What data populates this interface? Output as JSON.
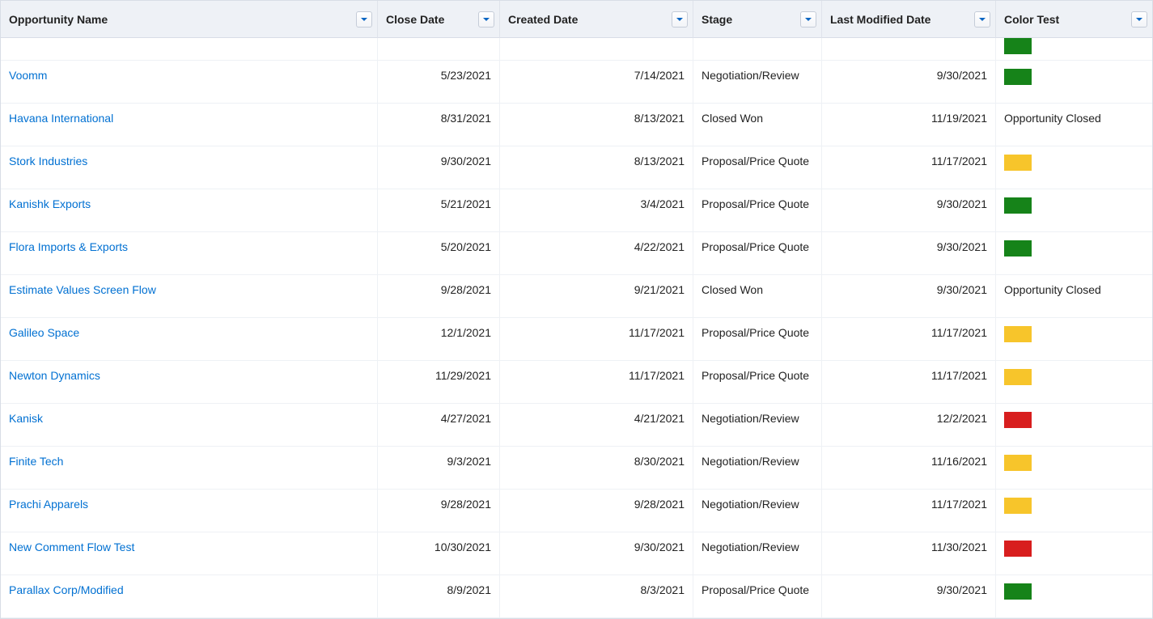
{
  "columns": [
    {
      "key": "name",
      "label": "Opportunity Name"
    },
    {
      "key": "close",
      "label": "Close Date"
    },
    {
      "key": "created",
      "label": "Created Date"
    },
    {
      "key": "stage",
      "label": "Stage"
    },
    {
      "key": "modified",
      "label": "Last Modified Date"
    },
    {
      "key": "color",
      "label": "Color Test"
    }
  ],
  "colors": {
    "green": "#168319",
    "yellow": "#f7c52b",
    "red": "#d81e1e"
  },
  "rows": [
    {
      "name": "",
      "close": "",
      "created": "",
      "stage": "",
      "modified": "",
      "color_type": "swatch",
      "color_value": "green",
      "partial": true
    },
    {
      "name": "Voomm",
      "close": "5/23/2021",
      "created": "7/14/2021",
      "stage": "Negotiation/Review",
      "modified": "9/30/2021",
      "color_type": "swatch",
      "color_value": "green"
    },
    {
      "name": "Havana International",
      "close": "8/31/2021",
      "created": "8/13/2021",
      "stage": "Closed Won",
      "modified": "11/19/2021",
      "color_type": "text",
      "color_value": "Opportunity Closed"
    },
    {
      "name": "Stork Industries",
      "close": "9/30/2021",
      "created": "8/13/2021",
      "stage": "Proposal/Price Quote",
      "modified": "11/17/2021",
      "color_type": "swatch",
      "color_value": "yellow"
    },
    {
      "name": "Kanishk Exports",
      "close": "5/21/2021",
      "created": "3/4/2021",
      "stage": "Proposal/Price Quote",
      "modified": "9/30/2021",
      "color_type": "swatch",
      "color_value": "green"
    },
    {
      "name": "Flora Imports & Exports",
      "close": "5/20/2021",
      "created": "4/22/2021",
      "stage": "Proposal/Price Quote",
      "modified": "9/30/2021",
      "color_type": "swatch",
      "color_value": "green"
    },
    {
      "name": "Estimate Values Screen Flow",
      "close": "9/28/2021",
      "created": "9/21/2021",
      "stage": "Closed Won",
      "modified": "9/30/2021",
      "color_type": "text",
      "color_value": "Opportunity Closed"
    },
    {
      "name": "Galileo Space",
      "close": "12/1/2021",
      "created": "11/17/2021",
      "stage": "Proposal/Price Quote",
      "modified": "11/17/2021",
      "color_type": "swatch",
      "color_value": "yellow"
    },
    {
      "name": "Newton Dynamics",
      "close": "11/29/2021",
      "created": "11/17/2021",
      "stage": "Proposal/Price Quote",
      "modified": "11/17/2021",
      "color_type": "swatch",
      "color_value": "yellow"
    },
    {
      "name": "Kanisk",
      "close": "4/27/2021",
      "created": "4/21/2021",
      "stage": "Negotiation/Review",
      "modified": "12/2/2021",
      "color_type": "swatch",
      "color_value": "red"
    },
    {
      "name": "Finite Tech",
      "close": "9/3/2021",
      "created": "8/30/2021",
      "stage": "Negotiation/Review",
      "modified": "11/16/2021",
      "color_type": "swatch",
      "color_value": "yellow"
    },
    {
      "name": "Prachi Apparels",
      "close": "9/28/2021",
      "created": "9/28/2021",
      "stage": "Negotiation/Review",
      "modified": "11/17/2021",
      "color_type": "swatch",
      "color_value": "yellow"
    },
    {
      "name": "New Comment Flow Test",
      "close": "10/30/2021",
      "created": "9/30/2021",
      "stage": "Negotiation/Review",
      "modified": "11/30/2021",
      "color_type": "swatch",
      "color_value": "red"
    },
    {
      "name": "Parallax Corp/Modified",
      "close": "8/9/2021",
      "created": "8/3/2021",
      "stage": "Proposal/Price Quote",
      "modified": "9/30/2021",
      "color_type": "swatch",
      "color_value": "green"
    }
  ]
}
